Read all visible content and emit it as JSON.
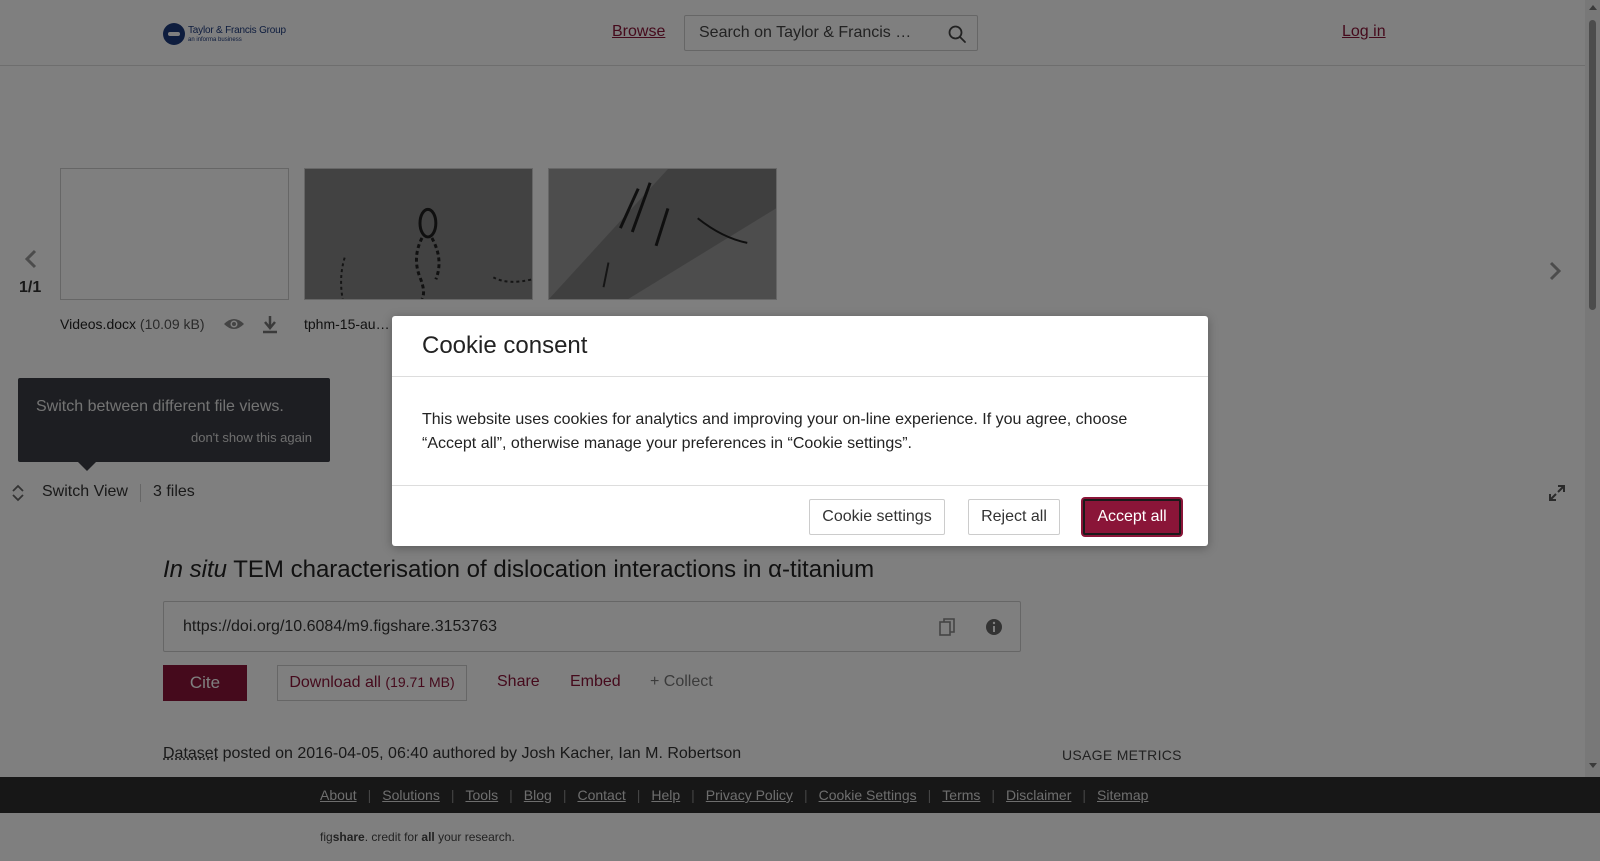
{
  "header": {
    "logo_main": "Taylor & Francis Group",
    "logo_sub": "an informa business",
    "browse": "Browse",
    "search_placeholder": "Search on Taylor & Francis …",
    "login": "Log in"
  },
  "gallery": {
    "page_count": "1/1",
    "files": [
      {
        "name": "Videos.docx",
        "size": "(10.09 kB)"
      },
      {
        "name": "tphm-15-au…"
      }
    ]
  },
  "tooltip": {
    "text": "Switch between different file views.",
    "dismiss": "don't show this again"
  },
  "switch_bar": {
    "label": "Switch View",
    "files_count": "3 files"
  },
  "article": {
    "title_italic": "In situ",
    "title_rest": " TEM characterisation of dislocation interactions in α-titanium",
    "doi": "https://doi.org/10.6084/m9.figshare.3153763",
    "cite": "Cite",
    "download_label": "Download all",
    "download_size": "(19.71 MB)",
    "share": "Share",
    "embed": "Embed",
    "collect": "+ Collect",
    "item_type": "Dataset",
    "posted_text": " posted on 2016-04-05, 06:40 authored by Josh Kacher, Ian M. Robertson",
    "usage_metrics": "USAGE METRICS"
  },
  "footer": {
    "links": [
      "About",
      "Solutions",
      "Tools",
      "Blog",
      "Contact",
      "Help",
      "Privacy Policy",
      "Cookie Settings",
      "Terms",
      "Disclaimer",
      "Sitemap"
    ],
    "credit_fig": "fig",
    "credit_share": "share",
    "credit_mid": ". credit for ",
    "credit_all": "all",
    "credit_end": " your research."
  },
  "cookie_modal": {
    "title": "Cookie consent",
    "body": "This website uses cookies for analytics and improving your on-line experience. If you agree, choose “Accept all”, otherwise manage your preferences in “Cookie settings”.",
    "settings_button": "Cookie settings",
    "reject_button": "Reject all",
    "accept_button": "Accept all"
  },
  "colors": {
    "brand": "#8a1538",
    "footer_bg": "#2e2e2e",
    "tooltip_bg": "#3a3d44",
    "overlay": "rgba(0,0,0,0.5)"
  }
}
